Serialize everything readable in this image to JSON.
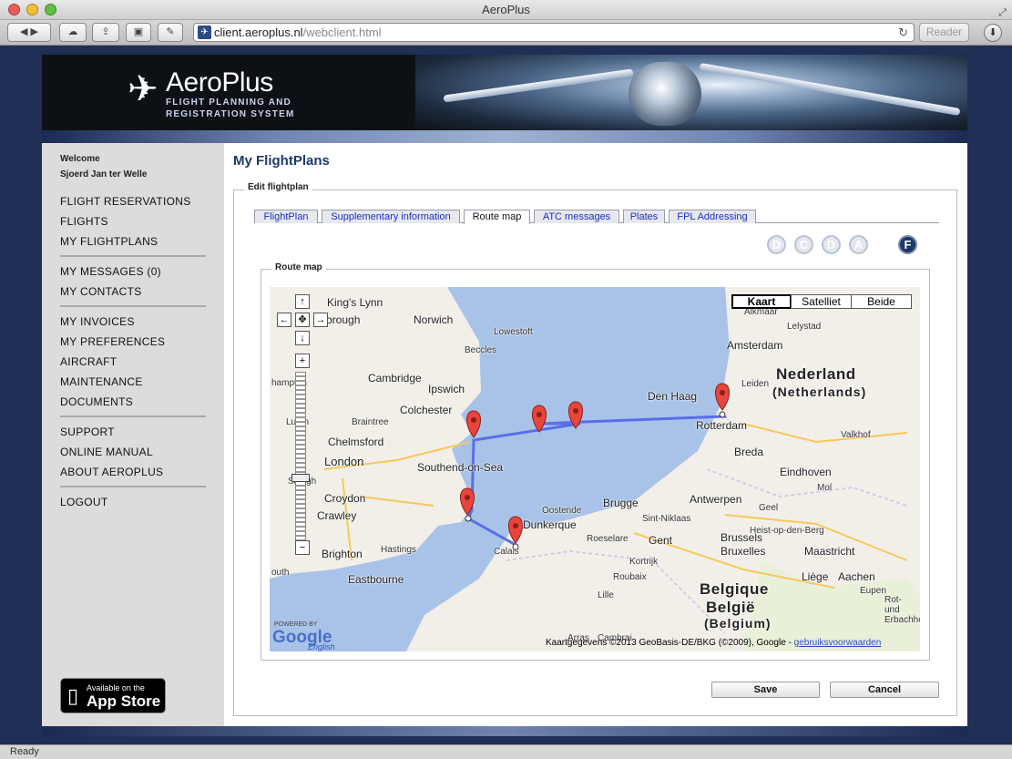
{
  "window": {
    "title": "AeroPlus"
  },
  "browser": {
    "url_host": "client.aeroplus.nl",
    "url_path": "/webclient.html",
    "reader_label": "Reader",
    "status": "Ready"
  },
  "header": {
    "brand_name": "AeroPlus",
    "tagline_line1": "FLIGHT PLANNING AND",
    "tagline_line2": "REGISTRATION SYSTEM"
  },
  "sidebar": {
    "welcome_label": "Welcome",
    "user_name": "Sjoerd Jan ter Welle",
    "groups": [
      [
        "FLIGHT RESERVATIONS",
        "FLIGHTS",
        "MY FLIGHTPLANS"
      ],
      [
        "MY MESSAGES (0)",
        "MY CONTACTS"
      ],
      [
        "MY INVOICES",
        "MY PREFERENCES",
        "AIRCRAFT",
        "MAINTENANCE",
        "DOCUMENTS"
      ],
      [
        "SUPPORT",
        "ONLINE MANUAL",
        "ABOUT AEROPLUS"
      ],
      [
        "LOGOUT"
      ]
    ],
    "appstore_small": "Available on the",
    "appstore_big": "App Store"
  },
  "main": {
    "title": "My FlightPlans",
    "section_legend": "Edit flightplan",
    "tabs": [
      "FlightPlan",
      "Supplementary information",
      "Route map",
      "ATC messages",
      "Plates",
      "FPL Addressing"
    ],
    "active_tab": "Route map",
    "status_circles": [
      "D",
      "C",
      "D",
      "A",
      "F"
    ],
    "route_legend": "Route map",
    "save_label": "Save",
    "cancel_label": "Cancel"
  },
  "map": {
    "map_types": [
      "Kaart",
      "Satelliet",
      "Beide"
    ],
    "active_map_type": "Kaart",
    "labels": [
      "King's Lynn",
      "Norwich",
      "Lowestoft",
      "Beccles",
      "orough",
      "Cambridge",
      "Ipswich",
      "Colchester",
      "Braintree",
      "Chelmsford",
      "London",
      "Southend-on-Sea",
      "Croydon",
      "Crawley",
      "Brighton",
      "Hastings",
      "Eastbourne",
      "hampton",
      "Luton",
      "Slough",
      "outh",
      "Den Haag",
      "Rotterdam",
      "Amsterdam",
      "Leiden",
      "Lelystad",
      "Alkmaar",
      "Breda",
      "Eindhoven",
      "Antwerpen",
      "Brugge",
      "Oostende",
      "Gent",
      "Kortrijk",
      "Roubaix",
      "Lille",
      "Brussels",
      "Bruxelles",
      "Dunkerque",
      "Calais",
      "Sint-Niklaas",
      "Roeselare",
      "Geel",
      "Heist-op-den-Berg",
      "Maastricht",
      "Liège",
      "Aachen",
      "Arras",
      "Cambrai",
      "Valkhof",
      "Rot- und Erbachhof",
      "Eupen",
      "Mol"
    ],
    "country_nl": "Nederland",
    "country_nl_sub": "(Netherlands)",
    "country_be1": "Belgique",
    "country_be2": "België",
    "country_be3": "(Belgium)",
    "powered_by": "POWERED BY",
    "google": "Google",
    "google_lang": "English",
    "copyright": "Kaartgegevens ©2013 GeoBasis-DE/BKG (©2009), Google - ",
    "terms_link": "gebruiksvoorwaarden",
    "route_color": "#5a6ee8"
  }
}
